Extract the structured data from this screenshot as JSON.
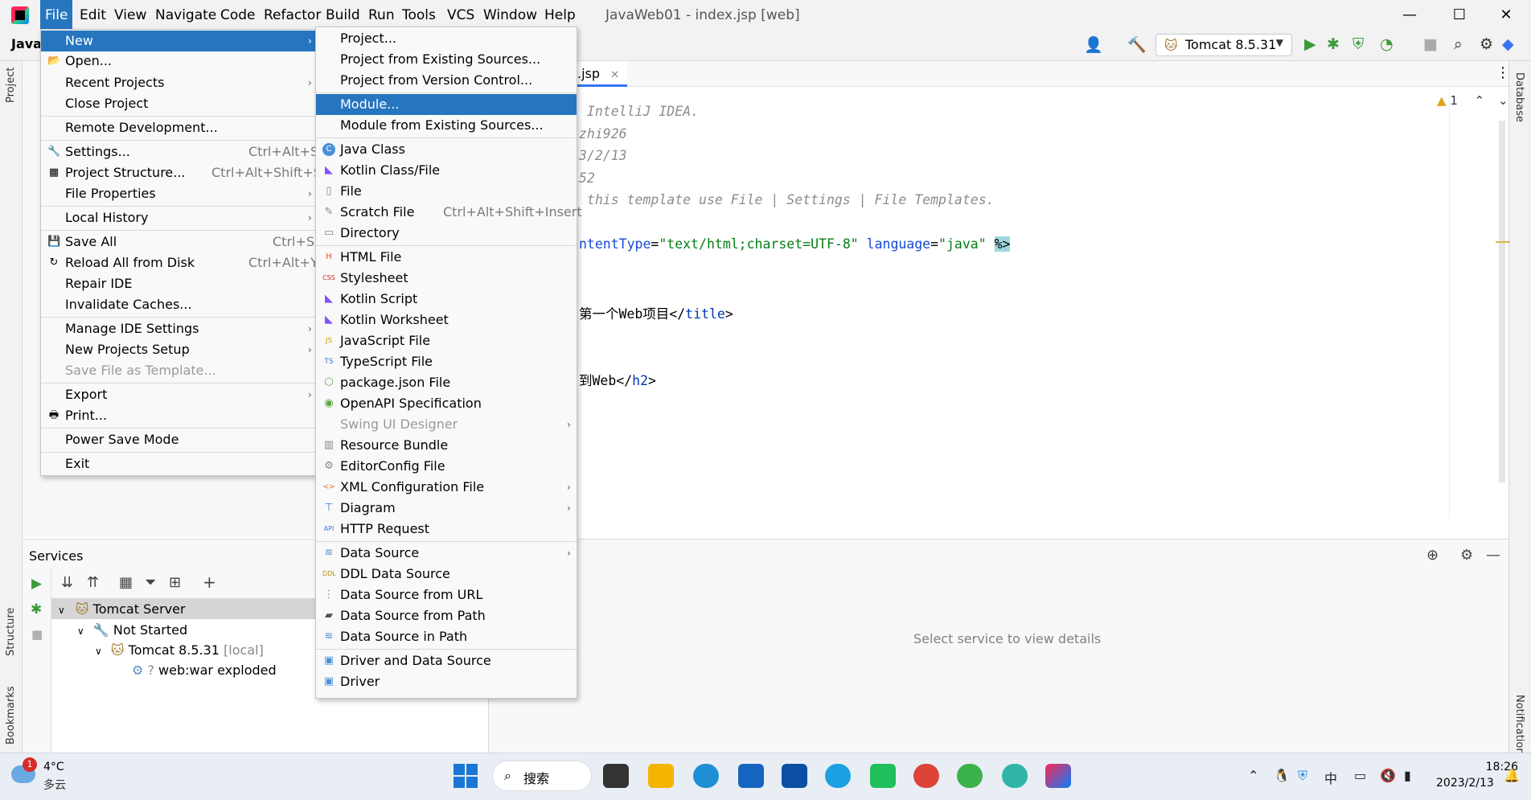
{
  "titlebar": {
    "menus": [
      "File",
      "Edit",
      "View",
      "Navigate",
      "Code",
      "Refactor",
      "Build",
      "Run",
      "Tools",
      "VCS",
      "Window",
      "Help"
    ],
    "window_title": "JavaWeb01 - index.jsp [web]",
    "minimize": "—",
    "maximize": "☐",
    "close": "✕"
  },
  "toolbar": {
    "project_label": "Java",
    "run_config": "Tomcat 8.5.31"
  },
  "left_strip": {
    "project": "Project",
    "structure": "Structure",
    "bookmarks": "Bookmarks"
  },
  "right_strip": {
    "database": "Database",
    "notifications": "Notifications"
  },
  "editor": {
    "tab": ".jsp",
    "warnings": "1",
    "lines": {
      "l1": " IntelliJ IDEA.",
      "l2": "zhi926",
      "l3": "3/2/13",
      "l4": "52",
      "l5": " this template use File | Settings | File Templates.",
      "l6_attr1": "ntentType",
      "l6_eq1": "=",
      "l6_val1": "\"text/html;charset=UTF-8\"",
      "l6_attr2": " language",
      "l6_eq2": "=",
      "l6_val2": "\"java\"",
      "l6_end": "%>",
      "l7_text": "第一个Web项目</",
      "l7_tag": "title",
      "l7_close": ">",
      "l8_text": "到Web</",
      "l8_tag": "h2",
      "l8_close": ">"
    }
  },
  "services": {
    "title": "Services",
    "tree": {
      "server": "Tomcat Server",
      "not_started": "Not Started",
      "tomcat": "Tomcat 8.5.31",
      "local": "[local]",
      "artifact": "web:war exploded"
    },
    "detail": "Select service to view details"
  },
  "file_menu": {
    "new": "New",
    "open": "Open...",
    "recent": "Recent Projects",
    "close_project": "Close Project",
    "remote": "Remote Development...",
    "settings": "Settings...",
    "settings_sc": "Ctrl+Alt+S",
    "structure": "Project Structure...",
    "structure_sc": "Ctrl+Alt+Shift+S",
    "file_props": "File Properties",
    "local_history": "Local History",
    "save_all": "Save All",
    "save_all_sc": "Ctrl+S",
    "reload": "Reload All from Disk",
    "reload_sc": "Ctrl+Alt+Y",
    "repair": "Repair IDE",
    "invalidate": "Invalidate Caches...",
    "manage": "Manage IDE Settings",
    "new_setup": "New Projects Setup",
    "save_template": "Save File as Template...",
    "export": "Export",
    "print": "Print...",
    "power_save": "Power Save Mode",
    "exit": "Exit"
  },
  "new_menu": {
    "project": "Project...",
    "from_existing": "Project from Existing Sources...",
    "from_vcs": "Project from Version Control...",
    "module": "Module...",
    "module_existing": "Module from Existing Sources...",
    "java_class": "Java Class",
    "kotlin_class": "Kotlin Class/File",
    "file": "File",
    "scratch": "Scratch File",
    "scratch_sc": "Ctrl+Alt+Shift+Insert",
    "directory": "Directory",
    "html": "HTML File",
    "stylesheet": "Stylesheet",
    "kotlin_script": "Kotlin Script",
    "kotlin_ws": "Kotlin Worksheet",
    "js": "JavaScript File",
    "ts": "TypeScript File",
    "package_json": "package.json File",
    "openapi": "OpenAPI Specification",
    "swing": "Swing UI Designer",
    "resource": "Resource Bundle",
    "editorconfig": "EditorConfig File",
    "xml": "XML Configuration File",
    "diagram": "Diagram",
    "http": "HTTP Request",
    "data_source": "Data Source",
    "ddl": "DDL Data Source",
    "ds_url": "Data Source from URL",
    "ds_path": "Data Source from Path",
    "ds_in_path": "Data Source in Path",
    "driver_ds": "Driver and Data Source",
    "driver": "Driver"
  },
  "taskbar": {
    "badge": "1",
    "temp": "4°C",
    "condition": "多云",
    "search": "搜索",
    "time": "18:26",
    "date": "2023/2/13",
    "ime": "中"
  }
}
